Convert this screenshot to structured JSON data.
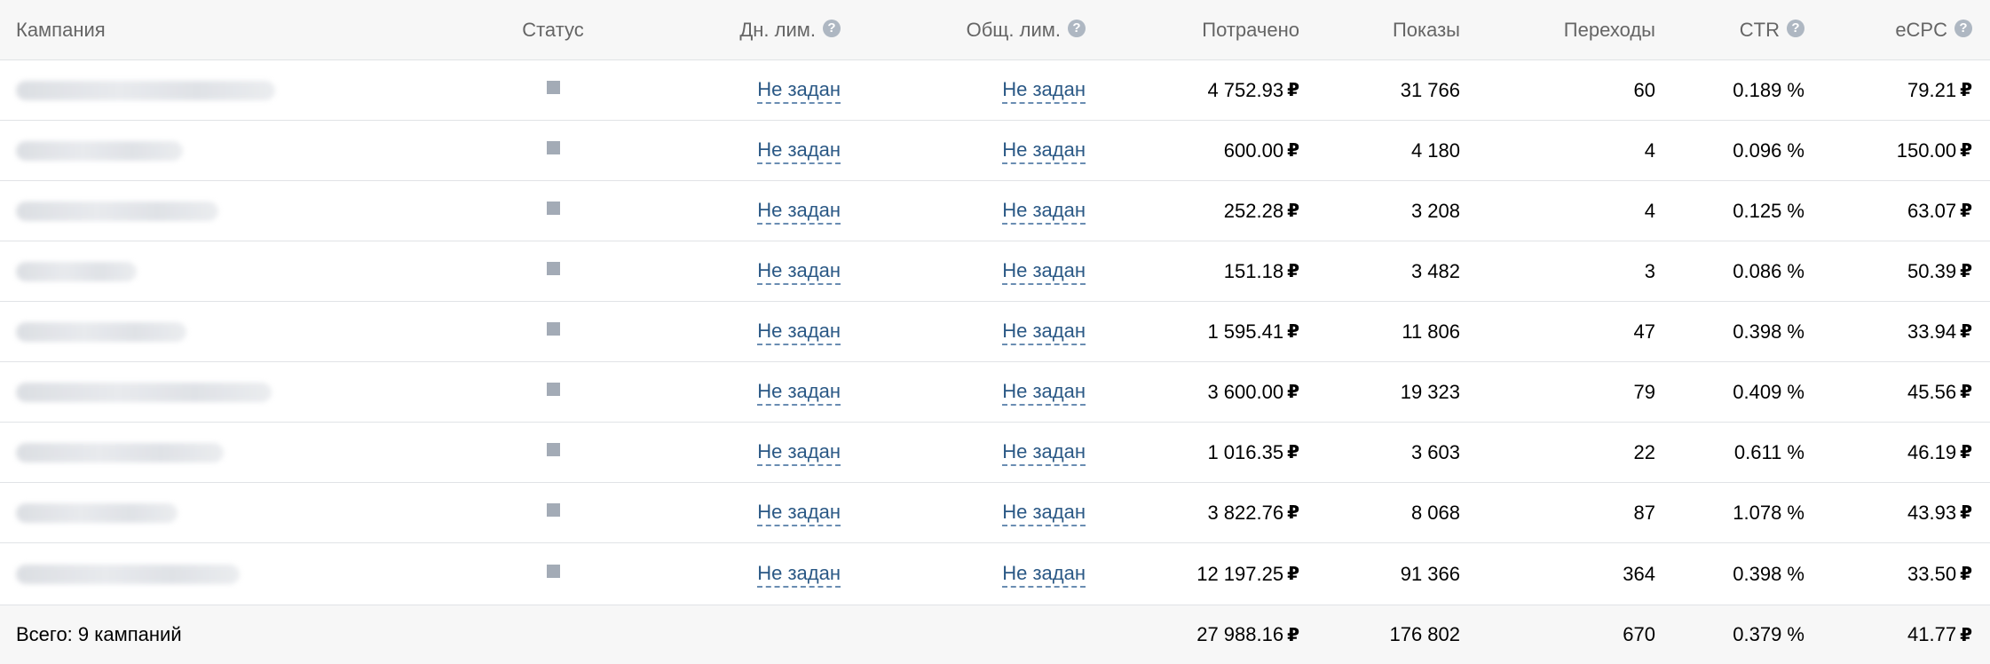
{
  "header": {
    "campaign": "Кампания",
    "status": "Статус",
    "day_limit": "Дн. лим.",
    "total_limit": "Общ. лим.",
    "spent": "Потрачено",
    "views": "Показы",
    "clicks": "Переходы",
    "ctr": "CTR",
    "ecpc": "eCPC",
    "help_glyph": "?"
  },
  "currency_symbol": "₽",
  "rows": [
    {
      "day_limit": "Не задан",
      "total_limit": "Не задан",
      "spent": "4 752.93",
      "views": "31 766",
      "clicks": "60",
      "ctr": "0.189 %",
      "ecpc": "79.21"
    },
    {
      "day_limit": "Не задан",
      "total_limit": "Не задан",
      "spent": "600.00",
      "views": "4 180",
      "clicks": "4",
      "ctr": "0.096 %",
      "ecpc": "150.00"
    },
    {
      "day_limit": "Не задан",
      "total_limit": "Не задан",
      "spent": "252.28",
      "views": "3 208",
      "clicks": "4",
      "ctr": "0.125 %",
      "ecpc": "63.07"
    },
    {
      "day_limit": "Не задан",
      "total_limit": "Не задан",
      "spent": "151.18",
      "views": "3 482",
      "clicks": "3",
      "ctr": "0.086 %",
      "ecpc": "50.39"
    },
    {
      "day_limit": "Не задан",
      "total_limit": "Не задан",
      "spent": "1 595.41",
      "views": "11 806",
      "clicks": "47",
      "ctr": "0.398 %",
      "ecpc": "33.94"
    },
    {
      "day_limit": "Не задан",
      "total_limit": "Не задан",
      "spent": "3 600.00",
      "views": "19 323",
      "clicks": "79",
      "ctr": "0.409 %",
      "ecpc": "45.56"
    },
    {
      "day_limit": "Не задан",
      "total_limit": "Не задан",
      "spent": "1 016.35",
      "views": "3 603",
      "clicks": "22",
      "ctr": "0.611 %",
      "ecpc": "46.19"
    },
    {
      "day_limit": "Не задан",
      "total_limit": "Не задан",
      "spent": "3 822.76",
      "views": "8 068",
      "clicks": "87",
      "ctr": "1.078 %",
      "ecpc": "43.93"
    },
    {
      "day_limit": "Не задан",
      "total_limit": "Не задан",
      "spent": "12 197.25",
      "views": "91 366",
      "clicks": "364",
      "ctr": "0.398 %",
      "ecpc": "33.50"
    }
  ],
  "totals": {
    "label": "Всего: 9 кампаний",
    "spent": "27 988.16",
    "views": "176 802",
    "clicks": "670",
    "ctr": "0.379 %",
    "ecpc": "41.77"
  },
  "colors": {
    "link": "#2a5885",
    "status_icon": "#a3abb6",
    "header_bg": "#f7f7f7",
    "border": "#e1e3e6"
  },
  "icons": {
    "status": "stopped-square-icon",
    "help": "question-circle-icon"
  }
}
